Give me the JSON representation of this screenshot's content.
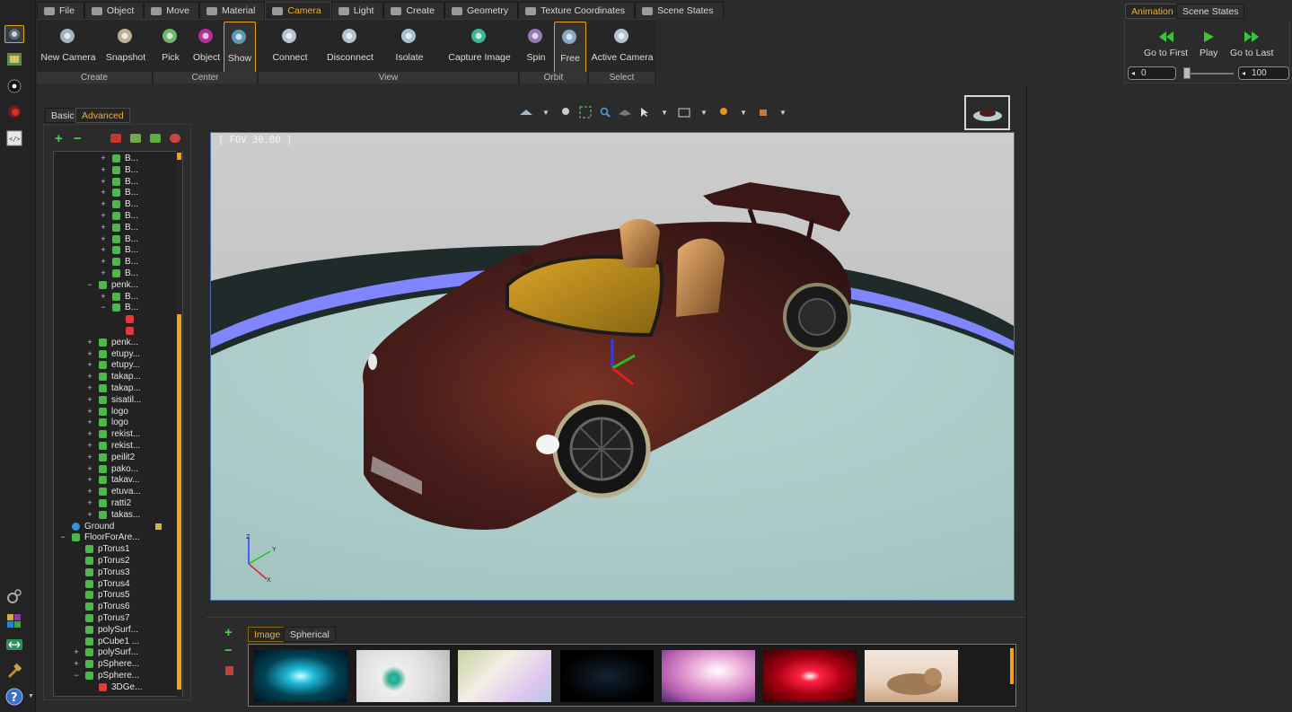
{
  "main_tabs": [
    {
      "label": "File",
      "icon": "folder-icon"
    },
    {
      "label": "Object",
      "icon": "object-icon"
    },
    {
      "label": "Move",
      "icon": "move-icon"
    },
    {
      "label": "Material",
      "icon": "material-sphere-icon"
    },
    {
      "label": "Camera",
      "icon": "camera-icon",
      "selected": true
    },
    {
      "label": "Light",
      "icon": "light-icon"
    },
    {
      "label": "Create",
      "icon": "create-icon"
    },
    {
      "label": "Geometry",
      "icon": "geometry-icon"
    },
    {
      "label": "Texture Coordinates",
      "icon": "texture-icon"
    },
    {
      "label": "Scene States",
      "icon": "scene-states-icon"
    }
  ],
  "ribbon": {
    "buttons": [
      {
        "label": "New Camera",
        "icon": "new-camera-icon"
      },
      {
        "label": "Snapshot",
        "icon": "snapshot-icon"
      },
      {
        "label": "Pick",
        "icon": "pick-crosshair-icon"
      },
      {
        "label": "Object",
        "icon": "center-object-icon"
      },
      {
        "label": "Show",
        "icon": "show-axes-icon",
        "selected": true
      },
      {
        "label": "Connect",
        "icon": "connect-icon"
      },
      {
        "label": "Disconnect",
        "icon": "disconnect-icon"
      },
      {
        "label": "Isolate",
        "icon": "isolate-icon"
      },
      {
        "label": "Capture Image",
        "icon": "capture-image-icon"
      },
      {
        "label": "Spin",
        "icon": "spin-icon"
      },
      {
        "label": "Free",
        "icon": "free-orbit-icon",
        "selected": true
      },
      {
        "label": "Active Camera",
        "icon": "active-camera-icon"
      }
    ],
    "groups": [
      "Create",
      "Center",
      "View",
      "Orbit",
      "Select"
    ]
  },
  "animation": {
    "tabs": [
      "Animation",
      "Scene States"
    ],
    "buttons": [
      {
        "label": "Go to First",
        "icon": "rewind-icon"
      },
      {
        "label": "Play",
        "icon": "play-icon"
      },
      {
        "label": "Go to Last",
        "icon": "fast-forward-icon"
      }
    ],
    "start_frame": "0",
    "end_frame": "100",
    "slider_position": 0
  },
  "scene_panel": {
    "tabs": [
      "Basic",
      "Advanced"
    ],
    "selected_tab": "Advanced",
    "tree": [
      {
        "label": "B...",
        "level": 4,
        "exp": "+"
      },
      {
        "label": "B...",
        "level": 4,
        "exp": "+"
      },
      {
        "label": "B...",
        "level": 4,
        "exp": "+"
      },
      {
        "label": "B...",
        "level": 4,
        "exp": "+"
      },
      {
        "label": "B...",
        "level": 4,
        "exp": "+"
      },
      {
        "label": "B...",
        "level": 4,
        "exp": "+"
      },
      {
        "label": "B...",
        "level": 4,
        "exp": "+"
      },
      {
        "label": "B...",
        "level": 4,
        "exp": "+"
      },
      {
        "label": "B...",
        "level": 4,
        "exp": "+"
      },
      {
        "label": "B...",
        "level": 4,
        "exp": "+"
      },
      {
        "label": "B...",
        "level": 4,
        "exp": "+"
      },
      {
        "label": "penk...",
        "level": 3,
        "exp": "−"
      },
      {
        "label": "B...",
        "level": 4,
        "exp": "+"
      },
      {
        "label": "B...",
        "level": 4,
        "exp": "−"
      },
      {
        "label": "",
        "level": 5,
        "exp": "",
        "red": true
      },
      {
        "label": "",
        "level": 5,
        "exp": "",
        "red": true
      },
      {
        "label": "penk...",
        "level": 3,
        "exp": "+"
      },
      {
        "label": "etupy...",
        "level": 3,
        "exp": "+"
      },
      {
        "label": "etupy...",
        "level": 3,
        "exp": "+"
      },
      {
        "label": "takap...",
        "level": 3,
        "exp": "+"
      },
      {
        "label": "takap...",
        "level": 3,
        "exp": "+"
      },
      {
        "label": "sisatil...",
        "level": 3,
        "exp": "+"
      },
      {
        "label": "logo",
        "level": 3,
        "exp": "+"
      },
      {
        "label": "logo",
        "level": 3,
        "exp": "+"
      },
      {
        "label": "rekist...",
        "level": 3,
        "exp": "+"
      },
      {
        "label": "rekist...",
        "level": 3,
        "exp": "+"
      },
      {
        "label": "peilit2",
        "level": 3,
        "exp": "+"
      },
      {
        "label": "pako...",
        "level": 3,
        "exp": "+"
      },
      {
        "label": "takav...",
        "level": 3,
        "exp": "+"
      },
      {
        "label": "etuva...",
        "level": 3,
        "exp": "+"
      },
      {
        "label": "ratti2",
        "level": 3,
        "exp": "+"
      },
      {
        "label": "takas...",
        "level": 3,
        "exp": "+"
      },
      {
        "label": "Ground",
        "level": 1,
        "exp": "",
        "globe": true,
        "locked": true
      },
      {
        "label": "FloorForAre...",
        "level": 1,
        "exp": "−"
      },
      {
        "label": "pTorus1",
        "level": 2,
        "exp": ""
      },
      {
        "label": "pTorus2",
        "level": 2,
        "exp": ""
      },
      {
        "label": "pTorus3",
        "level": 2,
        "exp": ""
      },
      {
        "label": "pTorus4",
        "level": 2,
        "exp": ""
      },
      {
        "label": "pTorus5",
        "level": 2,
        "exp": ""
      },
      {
        "label": "pTorus6",
        "level": 2,
        "exp": ""
      },
      {
        "label": "pTorus7",
        "level": 2,
        "exp": ""
      },
      {
        "label": "polySurf...",
        "level": 2,
        "exp": ""
      },
      {
        "label": "pCube1 ...",
        "level": 2,
        "exp": ""
      },
      {
        "label": "polySurf...",
        "level": 2,
        "exp": "+"
      },
      {
        "label": "pSphere...",
        "level": 2,
        "exp": "+"
      },
      {
        "label": "pSphere...",
        "level": 2,
        "exp": "−"
      },
      {
        "label": "3DGe...",
        "level": 3,
        "exp": "",
        "red": true
      }
    ]
  },
  "viewport": {
    "fov_label": "[ FOV 30.00 ]",
    "axis_labels": {
      "z": "Z",
      "y": "Y",
      "x": "X"
    }
  },
  "environment_panel": {
    "tabs": [
      "Image",
      "Spherical"
    ],
    "selected_tab": "Image",
    "thumbnails": [
      {
        "name": "teal-light-streaks"
      },
      {
        "name": "white-swirl-orb"
      },
      {
        "name": "pastel-rays"
      },
      {
        "name": "dark-blue-particles"
      },
      {
        "name": "pink-swirl"
      },
      {
        "name": "red-burst"
      },
      {
        "name": "sleeping-cat-photo"
      }
    ]
  },
  "colors": {
    "accent": "#f3b221",
    "car_body": "#4a1e1a",
    "floor": "#a9c9c6",
    "ring": "#7f86ff"
  }
}
